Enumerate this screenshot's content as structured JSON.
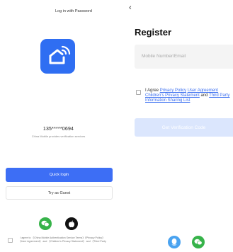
{
  "left": {
    "login_with_password": "Log in with Password",
    "phone_masked": "135*****0694",
    "carrier_note": "China Mobile provides verification services",
    "quick_login": "Quick login",
    "try_as_guest": "Try as Guest",
    "agreement": "I agree to 《China Mobile Authentication Service Terms》《Privacy Policy》《User Agreement》 and 《Children's Privacy Statement》 and 《Third Party"
  },
  "right": {
    "back_glyph": "‹",
    "title": "Register",
    "input_placeholder": "Mobile Number/Email",
    "agree_prefix": "I Agree ",
    "privacy_policy": "Privacy Policy",
    "user_agreement": "User Agreement",
    "childrens_privacy": "Children's Privacy Statement",
    "and": " and ",
    "third_party": "Third Party Information Sharing List",
    "get_code": "Get Verification Code"
  },
  "colors": {
    "primary": "#3d6ef5",
    "app_icon": "#2f6ef2",
    "wechat": "#37b34a",
    "qq": "#4aa3f0",
    "disabled_button": "#dbe6fd"
  },
  "icons": [
    "home-wifi-icon",
    "wechat-icon",
    "apple-icon",
    "qq-icon"
  ]
}
